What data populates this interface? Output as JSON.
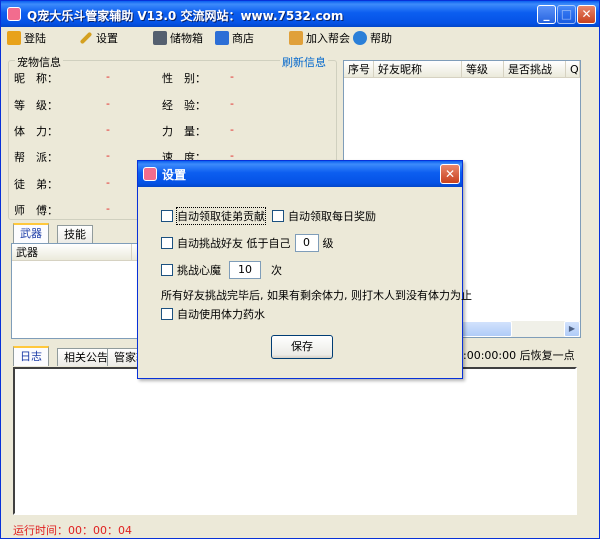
{
  "window": {
    "title": "Q宠大乐斗管家辅助 V13.0 交流网站：www.7532.com"
  },
  "toolbar": [
    {
      "label": "登陆",
      "icon": "login-icon",
      "color": "#E8A21A"
    },
    {
      "label": "设置",
      "icon": "wrench-icon",
      "color": "#D4A020"
    },
    {
      "label": "储物箱",
      "icon": "box-icon",
      "color": "#556070"
    },
    {
      "label": "商店",
      "icon": "shop-icon",
      "color": "#2C6ED6"
    },
    {
      "label": "加入帮会",
      "icon": "house-icon",
      "color": "#E0A03A"
    },
    {
      "label": "帮助",
      "icon": "help-icon",
      "color": "#2A7FD8"
    }
  ],
  "pet_info": {
    "group_label": "宠物信息",
    "refresh_link": "刷新信息",
    "left": [
      {
        "label": "昵　称：",
        "value": "-"
      },
      {
        "label": "等　级：",
        "value": "-"
      },
      {
        "label": "体　力：",
        "value": "-"
      },
      {
        "label": "帮　派：",
        "value": "-"
      },
      {
        "label": "徒　弟：",
        "value": "-"
      },
      {
        "label": "师　傅：",
        "value": "-"
      }
    ],
    "right": [
      {
        "label": "性　别：",
        "value": "-"
      },
      {
        "label": "经　验：",
        "value": "-"
      },
      {
        "label": "力　量：",
        "value": "-"
      },
      {
        "label": "速　度：",
        "value": "-"
      }
    ]
  },
  "friends_table": {
    "columns": [
      "序号",
      "好友昵称",
      "等级",
      "是否挑战",
      "QQ"
    ]
  },
  "equip_tabs": {
    "tabs": [
      "武器",
      "技能"
    ],
    "column": "武器"
  },
  "log_tabs": {
    "tabs": [
      "日志",
      "相关公告",
      "管家辅"
    ]
  },
  "recovery_text": ":00:00:00 后恢复一点",
  "status": {
    "runtime": "运行时间：00：00：04"
  },
  "dialog": {
    "title": "设置",
    "opt_apprentice": "自动领取徒弟贡献",
    "opt_daily": "自动领取每日奖励",
    "opt_challenge_prefix": "自动挑战好友  低于自己",
    "challenge_level": "0",
    "opt_challenge_suffix": "级",
    "opt_demon_prefix": "挑战心魔",
    "demon_times": "10",
    "opt_demon_suffix": "次",
    "note": "所有好友挑战完毕后, 如果有剩余体力, 则打木人到没有体力为止",
    "opt_potion": "自动使用体力药水",
    "save_label": "保存"
  }
}
